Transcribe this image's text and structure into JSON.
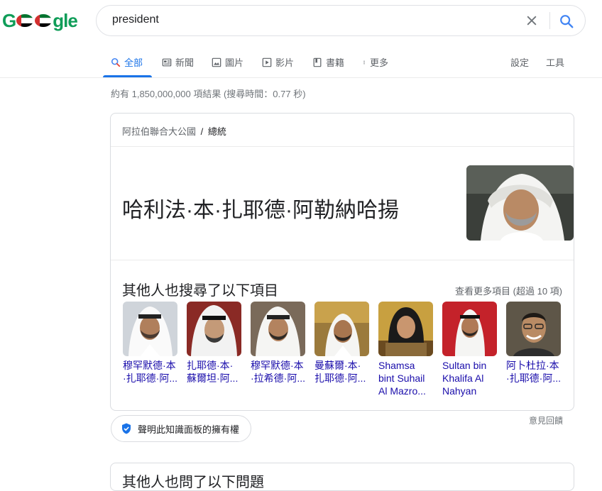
{
  "logo": {
    "left": "G",
    "right": "gle"
  },
  "search": {
    "query": "president"
  },
  "tabs": [
    {
      "label": "全部",
      "icon": "search-icon"
    },
    {
      "label": "新聞",
      "icon": "news-icon"
    },
    {
      "label": "圖片",
      "icon": "image-icon"
    },
    {
      "label": "影片",
      "icon": "video-icon"
    },
    {
      "label": "書籍",
      "icon": "book-icon"
    },
    {
      "label": "更多",
      "icon": "more-dots-icon"
    }
  ],
  "tools": {
    "settings": "設定",
    "tools": "工具"
  },
  "result_stats": "約有 1,850,000,000 項結果 (搜尋時間：0.77 秒)",
  "panel": {
    "breadcrumb_parent": "阿拉伯聯合大公國",
    "breadcrumb_sep": "/",
    "breadcrumb_current": "總統",
    "name": "哈利法·本·扎耶德·阿勒納哈揚",
    "pasf_title": "其他人也搜尋了以下項目",
    "more_link": "查看更多項目 (超過 10 項)",
    "people": [
      {
        "name": "穆罕默德·本·扎耶德·阿...",
        "photo": "portrait-photo"
      },
      {
        "name": "扎耶德·本·蘇爾坦·阿...",
        "photo": "portrait-photo"
      },
      {
        "name": "穆罕默德·本·拉希德·阿...",
        "photo": "portrait-photo"
      },
      {
        "name": "曼蘇爾·本·扎耶德·阿...",
        "photo": "portrait-photo"
      },
      {
        "name": "Shamsa bint Suhail Al Mazro...",
        "photo": "portrait-photo"
      },
      {
        "name": "Sultan bin Khalifa Al Nahyan",
        "photo": "portrait-photo"
      },
      {
        "name": "阿卜杜拉·本·扎耶德·阿...",
        "photo": "portrait-photo"
      }
    ],
    "feedback": "意見回饋",
    "claim": "聲明此知識面板的擁有權"
  },
  "next_section_title": "其他人也問了以下問題",
  "colors": {
    "accent": "#1a73e8",
    "link": "#1a0dab",
    "logo_green": "#0f9d58",
    "flag_red": "#d32f2f"
  }
}
